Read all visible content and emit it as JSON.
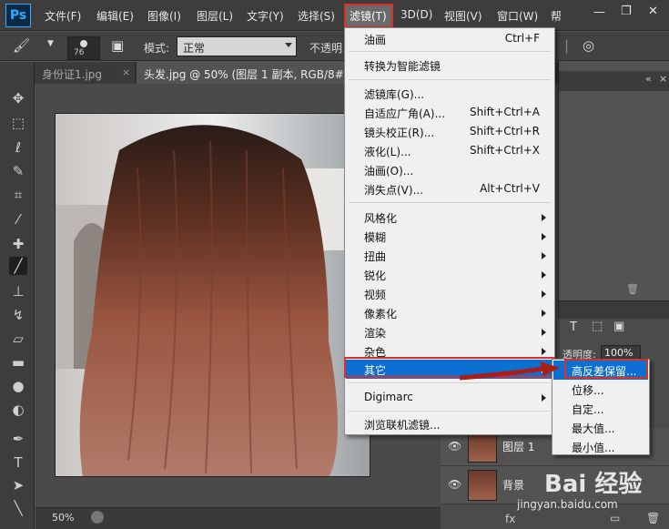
{
  "app": {
    "logo": "Ps"
  },
  "menubar": {
    "items": [
      "文件(F)",
      "编辑(E)",
      "图像(I)",
      "图层(L)",
      "文字(Y)",
      "选择(S)",
      "滤镜(T)",
      "3D(D)",
      "视图(V)",
      "窗口(W)",
      "帮"
    ]
  },
  "options": {
    "brush_size": "76",
    "mode_label": "模式:",
    "mode_value": "正常",
    "opacity_label": "不透明"
  },
  "tabs": [
    {
      "label": "身份证1.jpg"
    },
    {
      "label": "头发.jpg @ 50% (图层 1 副本, RGB/8#) *"
    }
  ],
  "filter_menu": {
    "items": [
      {
        "label": "油画",
        "shortcut": "Ctrl+F"
      },
      {
        "label": "转换为智能滤镜",
        "shortcut": ""
      },
      {
        "label": "滤镜库(G)...",
        "shortcut": ""
      },
      {
        "label": "自适应广角(A)...",
        "shortcut": "Shift+Ctrl+A"
      },
      {
        "label": "镜头校正(R)...",
        "shortcut": "Shift+Ctrl+R"
      },
      {
        "label": "液化(L)...",
        "shortcut": "Shift+Ctrl+X"
      },
      {
        "label": "油画(O)...",
        "shortcut": ""
      },
      {
        "label": "消失点(V)...",
        "shortcut": "Alt+Ctrl+V"
      },
      {
        "label": "风格化"
      },
      {
        "label": "模糊"
      },
      {
        "label": "扭曲"
      },
      {
        "label": "锐化"
      },
      {
        "label": "视频"
      },
      {
        "label": "像素化"
      },
      {
        "label": "渲染"
      },
      {
        "label": "杂色"
      },
      {
        "label": "其它"
      },
      {
        "label": "Digimarc"
      },
      {
        "label": "浏览联机滤镜..."
      }
    ]
  },
  "submenu": {
    "items": [
      "高反差保留...",
      "位移...",
      "自定...",
      "最大值...",
      "最小值..."
    ]
  },
  "layers": {
    "opacity_label": "透明度:",
    "opacity_value": "100%",
    "rows": [
      {
        "name": "图层 1"
      },
      {
        "name": "背景"
      }
    ]
  },
  "status": {
    "zoom": "50%"
  },
  "watermark": {
    "brand": "Bai 经验",
    "url": "jingyan.baidu.com"
  },
  "colors": {
    "highlight": "#0d6fd1",
    "callout": "#d9302a"
  }
}
